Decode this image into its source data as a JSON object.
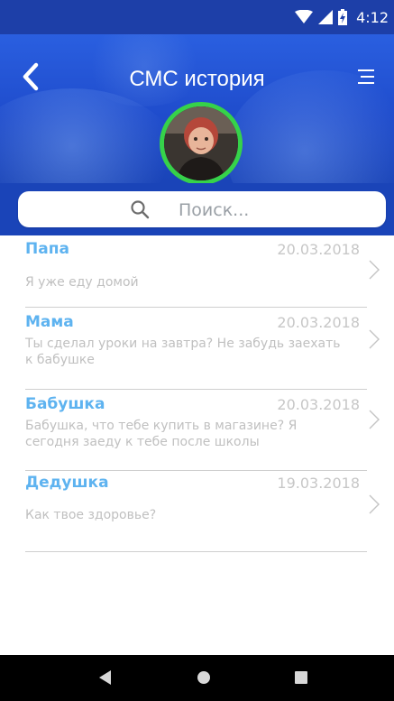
{
  "status_bar": {
    "time": "4:12"
  },
  "header": {
    "title": "СМС история"
  },
  "search": {
    "placeholder": "Поиск..."
  },
  "messages": [
    {
      "name": "Папа",
      "date": "20.03.2018",
      "preview": "Я уже еду домой"
    },
    {
      "name": "Мама",
      "date": "20.03.2018",
      "preview": "Ты сделал уроки на завтра? Не забудь заехать к бабушке"
    },
    {
      "name": "Бабушка",
      "date": "20.03.2018",
      "preview": "Бабушка, что тебе купить в магазине? Я сегодня заеду к тебе после школы"
    },
    {
      "name": "Дедушка",
      "date": "19.03.2018",
      "preview": "Как твое здоровье?"
    }
  ],
  "colors": {
    "header_blue": "#1f4ccc",
    "name_blue": "#5eb3f0",
    "avatar_ring": "#36d24a"
  },
  "icons": [
    "wifi-icon",
    "signal-icon",
    "battery-icon",
    "back-icon",
    "menu-icon",
    "search-icon",
    "chevron-right-icon",
    "nav-back-icon",
    "nav-home-icon",
    "nav-recent-icon"
  ]
}
